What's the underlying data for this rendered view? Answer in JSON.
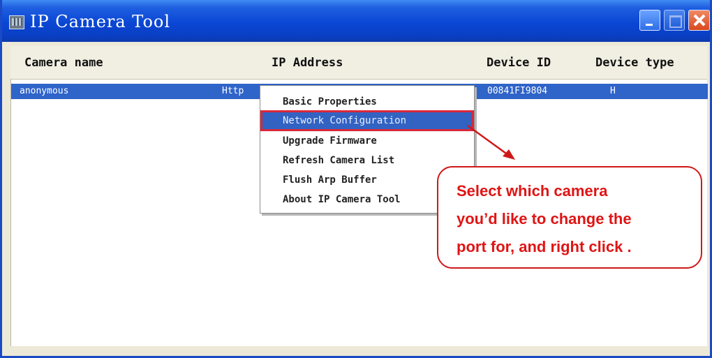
{
  "window": {
    "title": "IP Camera Tool"
  },
  "columns": [
    "Camera name",
    "IP Address",
    "Device ID",
    "Device type"
  ],
  "rows": [
    {
      "camera_name": "anonymous",
      "ip_address": "Http",
      "device_id": "00841FI9804",
      "device_type": "H"
    }
  ],
  "context_menu": {
    "items": [
      "Basic Properties",
      "Network Configuration",
      "Upgrade Firmware",
      "Refresh Camera List",
      "Flush Arp Buffer",
      "About IP Camera Tool"
    ],
    "selected": "Network Configuration"
  },
  "callout": {
    "lines": [
      "Select which camera",
      "you’d like to change the",
      "port for, and right click ."
    ]
  },
  "colors": {
    "titlebar": "#0a46d4",
    "selection": "#2f64c9",
    "highlight_border": "#d9283b",
    "annotation": "#e01414"
  },
  "icons": [
    "app-icon",
    "minimize-icon",
    "maximize-icon",
    "close-icon"
  ]
}
